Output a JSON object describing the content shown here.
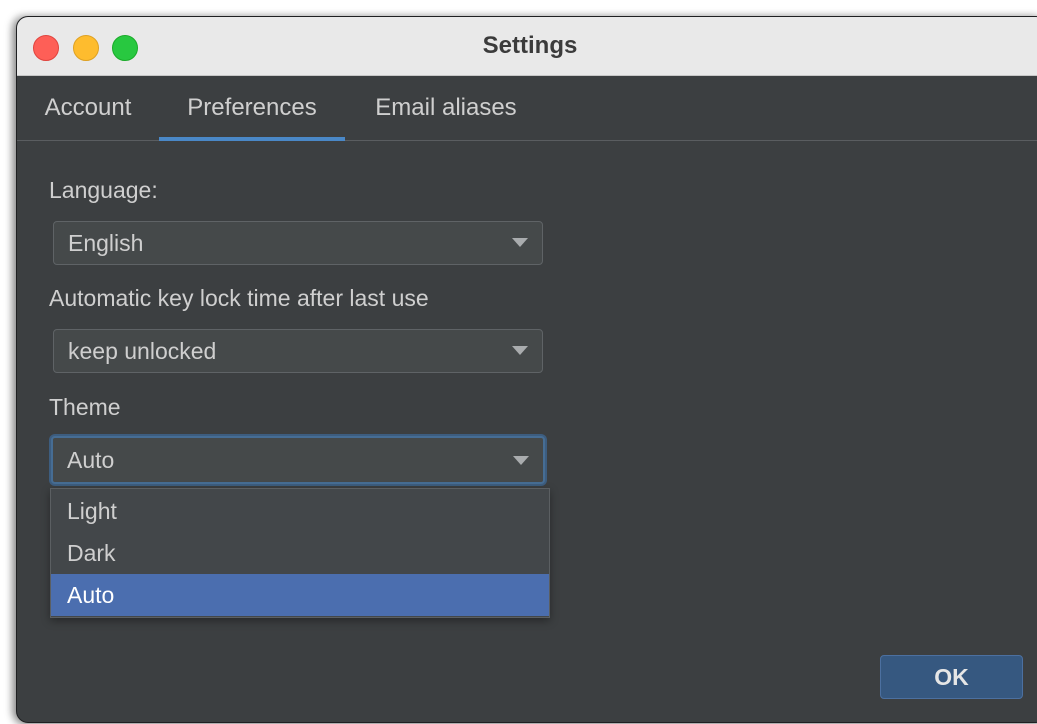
{
  "window": {
    "title": "Settings"
  },
  "tabs": [
    {
      "label": "Account"
    },
    {
      "label": "Preferences"
    },
    {
      "label": "Email aliases"
    }
  ],
  "preferences": {
    "language": {
      "label": "Language:",
      "value": "English"
    },
    "key_lock": {
      "label": "Automatic key lock time after last use",
      "value": "keep unlocked"
    },
    "theme": {
      "label": "Theme",
      "value": "Auto",
      "options": [
        "Light",
        "Dark",
        "Auto"
      ],
      "selected": "Auto"
    }
  },
  "footer": {
    "ok_label": "OK"
  },
  "colors": {
    "accent": "#4a88c7",
    "selection": "#4b6eaf",
    "background": "#3c3f41"
  }
}
